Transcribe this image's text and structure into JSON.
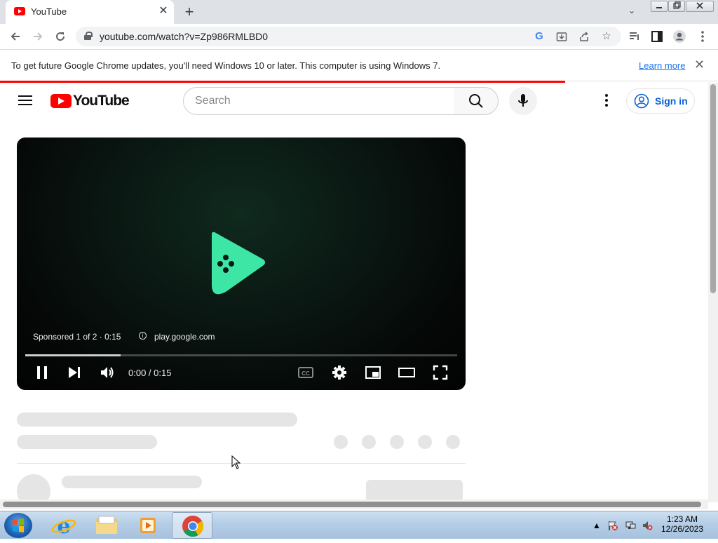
{
  "browser": {
    "tab_title": "YouTube",
    "tab_close": "✕",
    "new_tab": "+",
    "tab_search": "⌄",
    "url": "youtube.com/watch?v=Zp986RMLBD0",
    "infobar_text": "To get future Google Chrome updates, you'll need Windows 10 or later. This computer is using Windows 7.",
    "learn_more": "Learn more",
    "infobar_close": "✕"
  },
  "youtube": {
    "logo_text": "YouTube",
    "search_placeholder": "Search",
    "sign_in": "Sign in"
  },
  "player": {
    "sponsored": "Sponsored 1 of 2 · 0:15",
    "ad_domain": "play.google.com",
    "time": "0:00 / 0:15",
    "progress_fraction": 0.22
  },
  "taskbar": {
    "time": "1:23 AM",
    "date": "12/26/2023"
  },
  "colors": {
    "youtube_red": "#ff0000",
    "link_blue": "#065fd4",
    "play_logo_green": "#3ee6a6"
  }
}
